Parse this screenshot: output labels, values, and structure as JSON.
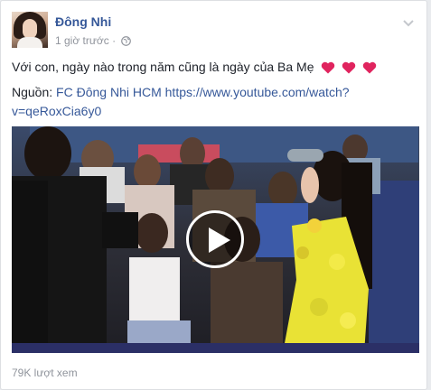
{
  "post": {
    "author": "Đông Nhi",
    "timestamp": "1 giờ trước",
    "separator": "·",
    "privacy_icon": "globe-icon",
    "options_icon": "chevron-down-icon",
    "message": "Với con, ngày nào trong năm cũng là ngày của Ba Mẹ",
    "message_icons": [
      "heart-icon",
      "heart-icon",
      "heart-icon"
    ],
    "source_label": "Nguồn:",
    "source_name": "FC Đông Nhi HCM",
    "source_url_line1": "https://www.youtube.com/watch?",
    "source_url_line2": "v=qeRoxCia6y0",
    "views": "79K lượt xem"
  },
  "video": {
    "play_icon": "play-icon"
  },
  "colors": {
    "link": "#365899",
    "heart": "#e0245e",
    "meta": "#90949c",
    "text": "#1d2129"
  }
}
